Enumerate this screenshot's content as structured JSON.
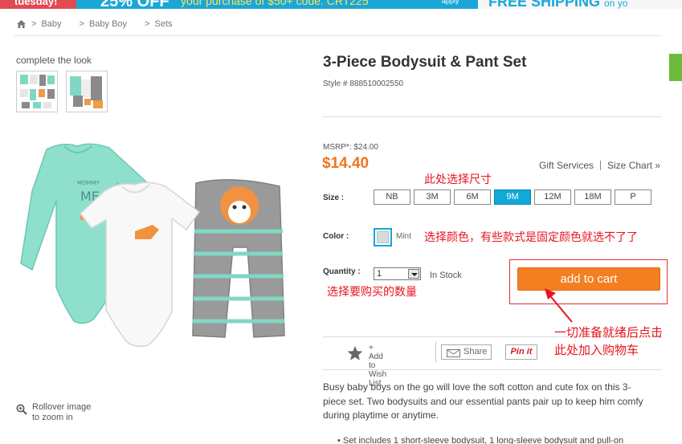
{
  "promo": {
    "left_text": "tuesday!",
    "percent": "25% OFF",
    "offer": "your purchase of $50+ code: CRT225",
    "apply": "apply",
    "shipping": "FREE SHIPPING",
    "shipping_suffix": "on yo"
  },
  "breadcrumb": {
    "home_icon": "home-icon",
    "items": [
      "Baby",
      "Baby Boy",
      "Sets"
    ]
  },
  "left": {
    "complete_the_look": "complete the look",
    "zoom_hint_line1": "Rollover image",
    "zoom_hint_line2": "to zoom in"
  },
  "product": {
    "title": "3-Piece Bodysuit & Pant Set",
    "style": "Style # 888510002550",
    "msrp": "MSRP*: $24.00",
    "price": "$14.40",
    "gift_services": "Gift Services",
    "size_chart": "Size Chart »",
    "size_label": "Size :",
    "sizes": [
      "NB",
      "3M",
      "6M",
      "9M",
      "12M",
      "18M",
      "P"
    ],
    "selected_size": "9M",
    "color_label": "Color :",
    "color_name": "Mint",
    "quantity_label": "Quantity :",
    "quantity_value": "1",
    "stock": "In Stock",
    "add_to_cart": "add to cart",
    "wishlist_line1": "+ Add to",
    "wishlist_line2": "Wish List",
    "share": "Share",
    "pinit": "Pin it",
    "description": "Busy baby boys on the go will love the soft cotton and cute fox on this 3-piece set. Two bodysuits and our essential pants pair up to keep him comfy during playtime or anytime.",
    "bullet": "• Set includes 1 short-sleeve bodysuit, 1 long-sleeve bodysuit and pull-on"
  },
  "annotations": {
    "size": "此处选择尺寸",
    "color": "选择颜色，有些款式是固定颜色就选不了了",
    "quantity": "选择要购买的数量",
    "cart": "一切准备就绪后点击此处加入购物车"
  },
  "colors": {
    "accent": "#12a8d8",
    "cart": "#f47f21",
    "price": "#f0741b",
    "annotation": "#e8141e"
  }
}
